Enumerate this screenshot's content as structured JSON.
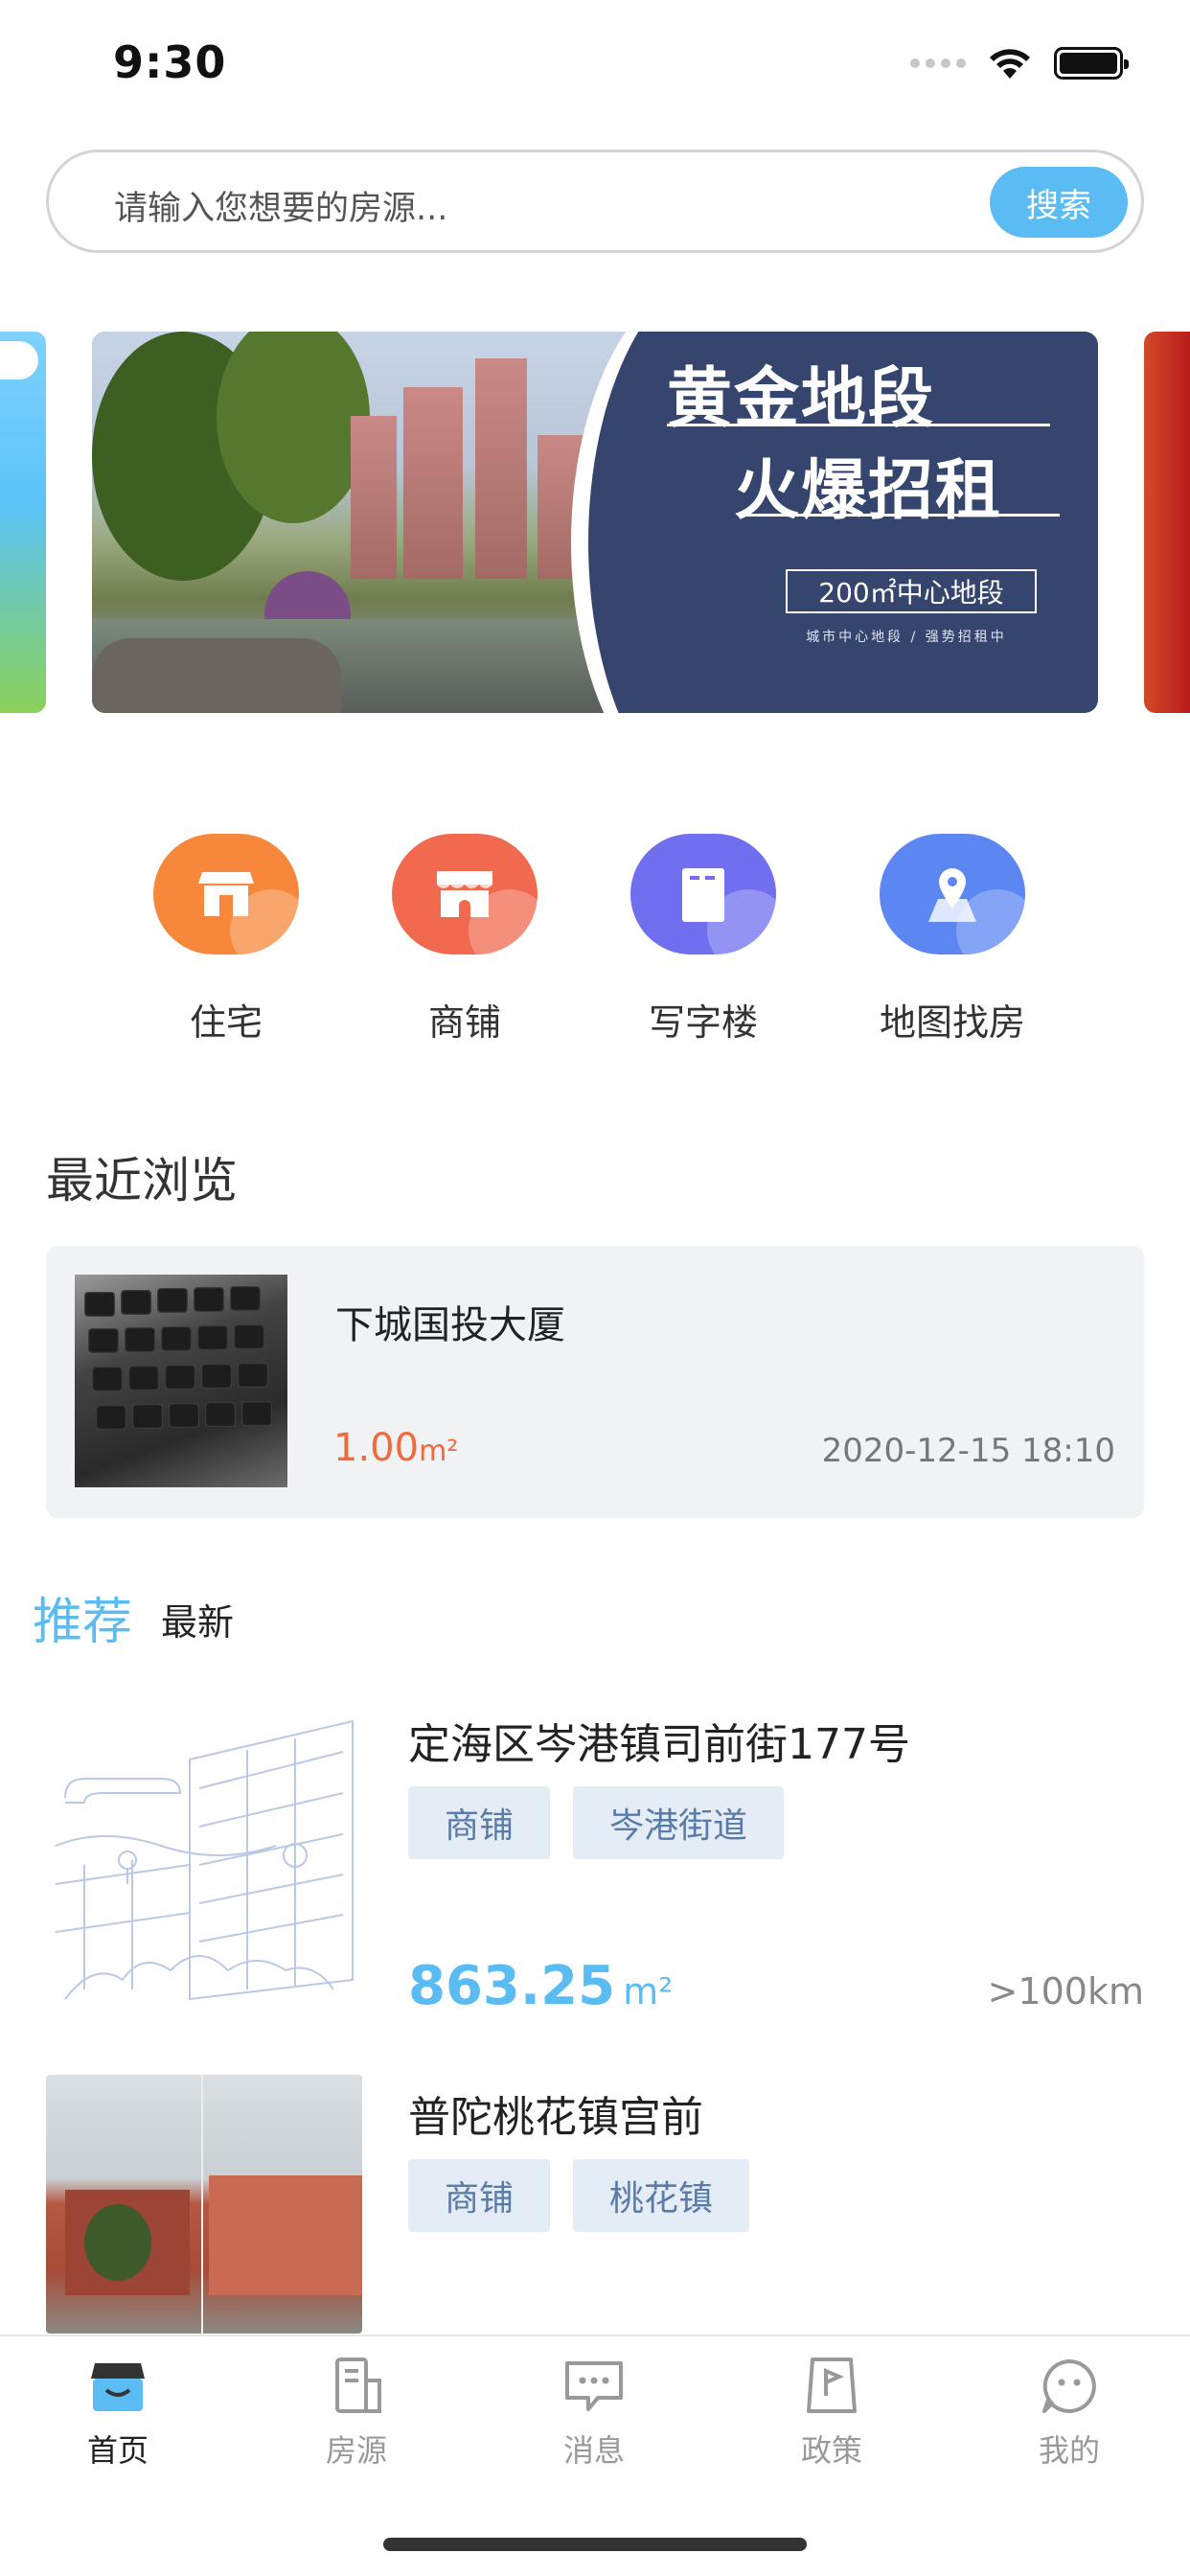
{
  "status_bar": {
    "time": "9:30"
  },
  "search": {
    "placeholder": "请输入您想要的房源...",
    "button_label": "搜索"
  },
  "banner": {
    "title_line1": "黄金地段",
    "title_line2": "火爆招租",
    "tag": "200㎡中心地段",
    "subtitle": "城市中心地段 / 强势招租中"
  },
  "categories": [
    {
      "label": "住宅",
      "icon": "house-icon",
      "color": "#f7873a"
    },
    {
      "label": "商铺",
      "icon": "shop-icon",
      "color": "#f16a4f"
    },
    {
      "label": "写字楼",
      "icon": "office-building-icon",
      "color": "#6f6ff0"
    },
    {
      "label": "地图找房",
      "icon": "map-pin-icon",
      "color": "#5c86f2"
    }
  ],
  "recent": {
    "section_title": "最近浏览",
    "item": {
      "name": "下城国投大厦",
      "area_value": "1.00",
      "area_unit": "m²",
      "time": "2020-12-15 18:10"
    }
  },
  "tabs": {
    "recommended": "推荐",
    "newest": "最新"
  },
  "listings": [
    {
      "title": "定海区岑港镇司前街177号",
      "tags": [
        "商铺",
        "岑港街道"
      ],
      "area_value": "863.25",
      "area_unit": "m²",
      "distance": ">100km"
    },
    {
      "title": "普陀桃花镇宫前",
      "tags": [
        "商铺",
        "桃花镇"
      ]
    }
  ],
  "bottom_nav": [
    {
      "label": "首页",
      "icon": "home-icon",
      "active": true
    },
    {
      "label": "房源",
      "icon": "listing-icon",
      "active": false
    },
    {
      "label": "消息",
      "icon": "message-icon",
      "active": false
    },
    {
      "label": "政策",
      "icon": "policy-flag-icon",
      "active": false
    },
    {
      "label": "我的",
      "icon": "profile-icon",
      "active": false
    }
  ],
  "colors": {
    "accent": "#5bbcf3",
    "price_orange": "#f06a3c",
    "tag_bg": "#e4ecf5",
    "tag_text": "#5a7aa8"
  }
}
